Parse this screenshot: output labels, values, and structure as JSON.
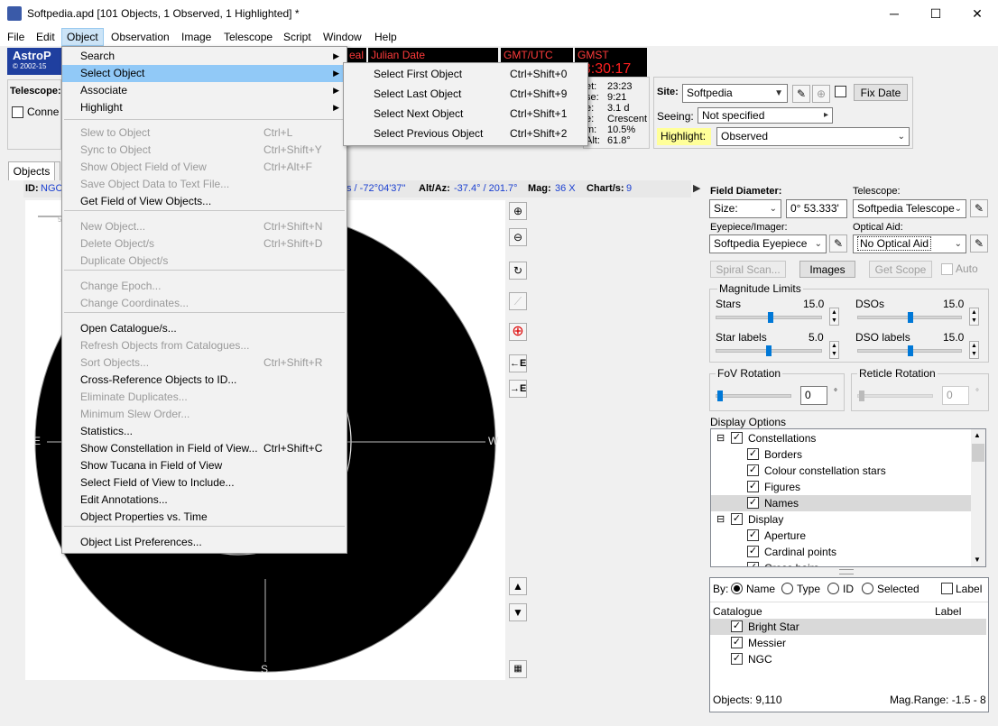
{
  "window": {
    "title": "Softpedia.apd [101 Objects, 1 Observed, 1 Highlighted] *",
    "min": "─",
    "max": "☐",
    "close": "✕"
  },
  "menubar": [
    "File",
    "Edit",
    "Object",
    "Observation",
    "Image",
    "Telescope",
    "Script",
    "Window",
    "Help"
  ],
  "banner": {
    "title": "AstroP",
    "copyright": "© 2002-15"
  },
  "time": {
    "julian_label": "Julian Date",
    "gmt_label": "GMT/UTC",
    "gmst_label": "GMST",
    "gmst_value": "13:30:17",
    "partial_label": "eal"
  },
  "telescope_panel": {
    "label": "Telescope:",
    "connect": "Conne"
  },
  "moon": {
    "labels": [
      "et:",
      "se:",
      "e:",
      "m:",
      "Alt:"
    ],
    "values": [
      "23:23",
      "9:21",
      "3.1 d",
      "Crescent",
      "10.5%",
      "61.8°"
    ],
    "extra_label": "lt:"
  },
  "site_panel": {
    "site_label": "Site:",
    "site_value": "Softpedia",
    "fix_date": "Fix Date",
    "seeing_label": "Seeing:",
    "seeing_value": "Not specified",
    "highlight_label": "Highlight:",
    "highlight_value": "Observed"
  },
  "tabs": {
    "objects": "Objects"
  },
  "infobar": {
    "id_label": "ID:",
    "id_value": "NGC",
    "coord": "s / -72°04'37\"",
    "altaz_label": "Alt/Az:",
    "altaz_value": "-37.4° / 201.7°",
    "mag_label": "Mag:",
    "mag_value": "36 X",
    "chart_label": "Chart/s:",
    "chart_value": "9"
  },
  "sky": {
    "east": "E",
    "west": "W",
    "south": "S",
    "tick": "5"
  },
  "object_menu": {
    "items": [
      {
        "label": "Search",
        "shortcut": "",
        "sub": true
      },
      {
        "label": "Select Object",
        "shortcut": "",
        "sub": true,
        "hl": true
      },
      {
        "label": "Associate",
        "shortcut": "",
        "sub": true
      },
      {
        "label": "Highlight",
        "shortcut": "",
        "sub": true
      },
      {
        "label": "Slew to Object",
        "shortcut": "Ctrl+L",
        "dis": true
      },
      {
        "label": "Sync to Object",
        "shortcut": "Ctrl+Shift+Y",
        "dis": true
      },
      {
        "label": "Show Object Field of View",
        "shortcut": "Ctrl+Alt+F",
        "dis": true
      },
      {
        "label": "Save Object Data to Text File...",
        "shortcut": "",
        "dis": true
      },
      {
        "label": "Get Field of View Objects...",
        "shortcut": ""
      },
      {
        "label": "New Object...",
        "shortcut": "Ctrl+Shift+N",
        "dis": true
      },
      {
        "label": "Delete Object/s",
        "shortcut": "Ctrl+Shift+D",
        "dis": true
      },
      {
        "label": "Duplicate Object/s",
        "shortcut": "",
        "dis": true
      },
      {
        "label": "Change Epoch...",
        "shortcut": "",
        "dis": true
      },
      {
        "label": "Change Coordinates...",
        "shortcut": "",
        "dis": true
      },
      {
        "label": "Open Catalogue/s...",
        "shortcut": ""
      },
      {
        "label": "Refresh Objects from Catalogues...",
        "shortcut": "",
        "dis": true
      },
      {
        "label": "Sort Objects...",
        "shortcut": "Ctrl+Shift+R",
        "dis": true
      },
      {
        "label": "Cross-Reference Objects to ID...",
        "shortcut": ""
      },
      {
        "label": "Eliminate Duplicates...",
        "shortcut": "",
        "dis": true
      },
      {
        "label": "Minimum Slew Order...",
        "shortcut": "",
        "dis": true
      },
      {
        "label": "Statistics...",
        "shortcut": ""
      },
      {
        "label": "Show Constellation in Field of View...",
        "shortcut": "Ctrl+Shift+C"
      },
      {
        "label": "Show Tucana in Field of View",
        "shortcut": ""
      },
      {
        "label": "Select Field of View to Include...",
        "shortcut": ""
      },
      {
        "label": "Edit Annotations...",
        "shortcut": ""
      },
      {
        "label": "Object Properties vs. Time",
        "shortcut": ""
      },
      {
        "label": "Object List Preferences...",
        "shortcut": ""
      }
    ]
  },
  "select_submenu": {
    "items": [
      {
        "label": "Select First Object",
        "shortcut": "Ctrl+Shift+0"
      },
      {
        "label": "Select Last Object",
        "shortcut": "Ctrl+Shift+9"
      },
      {
        "label": "Select Next Object",
        "shortcut": "Ctrl+Shift+1"
      },
      {
        "label": "Select Previous Object",
        "shortcut": "Ctrl+Shift+2"
      }
    ]
  },
  "right": {
    "field_diameter_label": "Field Diameter:",
    "size_value": "Size:",
    "fov_value": "0° 53.333'",
    "telescope_label": "Telescope:",
    "telescope_value": "Softpedia Telescope",
    "eyepiece_label": "Eyepiece/Imager:",
    "eyepiece_value": "Softpedia Eyepiece",
    "optical_label": "Optical Aid:",
    "optical_value": "No Optical Aid",
    "spiral": "Spiral Scan...",
    "images": "Images",
    "getscope": "Get Scope",
    "auto": "Auto",
    "maglimits": "Magnitude Limits",
    "stars_label": "Stars",
    "stars_value": "15.0",
    "stars_level": 0.55,
    "dsos_label": "DSOs",
    "dsos_value": "15.0",
    "dsos_level": 0.55,
    "starlabels_label": "Star labels",
    "starlabels_value": "5.0",
    "starlabels_level": 0.5,
    "dsolabels_label": "DSO labels",
    "dsolabels_value": "15.0",
    "dsolabels_level": 0.55,
    "fov_rot": "FoV Rotation",
    "fov_rot_value": "0",
    "ret_rot": "Reticle Rotation",
    "ret_rot_value": "0",
    "deg": "°",
    "display_options": "Display Options",
    "tree": [
      {
        "label": "Constellations",
        "level": 0,
        "expand": "⊟"
      },
      {
        "label": "Borders",
        "level": 1
      },
      {
        "label": "Colour constellation stars",
        "level": 1
      },
      {
        "label": "Figures",
        "level": 1
      },
      {
        "label": "Names",
        "level": 1,
        "sel": true
      },
      {
        "label": "Display",
        "level": 0,
        "expand": "⊟"
      },
      {
        "label": "Aperture",
        "level": 1
      },
      {
        "label": "Cardinal points",
        "level": 1
      },
      {
        "label": "Cross hairs",
        "level": 1
      }
    ],
    "by_label": "By:",
    "by_name": "Name",
    "by_type": "Type",
    "by_id": "ID",
    "by_selected": "Selected",
    "label_chk": "Label",
    "cat_header": "Catalogue",
    "label_header": "Label",
    "catalogues": [
      "Bright Star",
      "Messier",
      "NGC"
    ],
    "objects_count": "Objects: 9,110",
    "magrange": "Mag.Range: -1.5 - 8"
  }
}
